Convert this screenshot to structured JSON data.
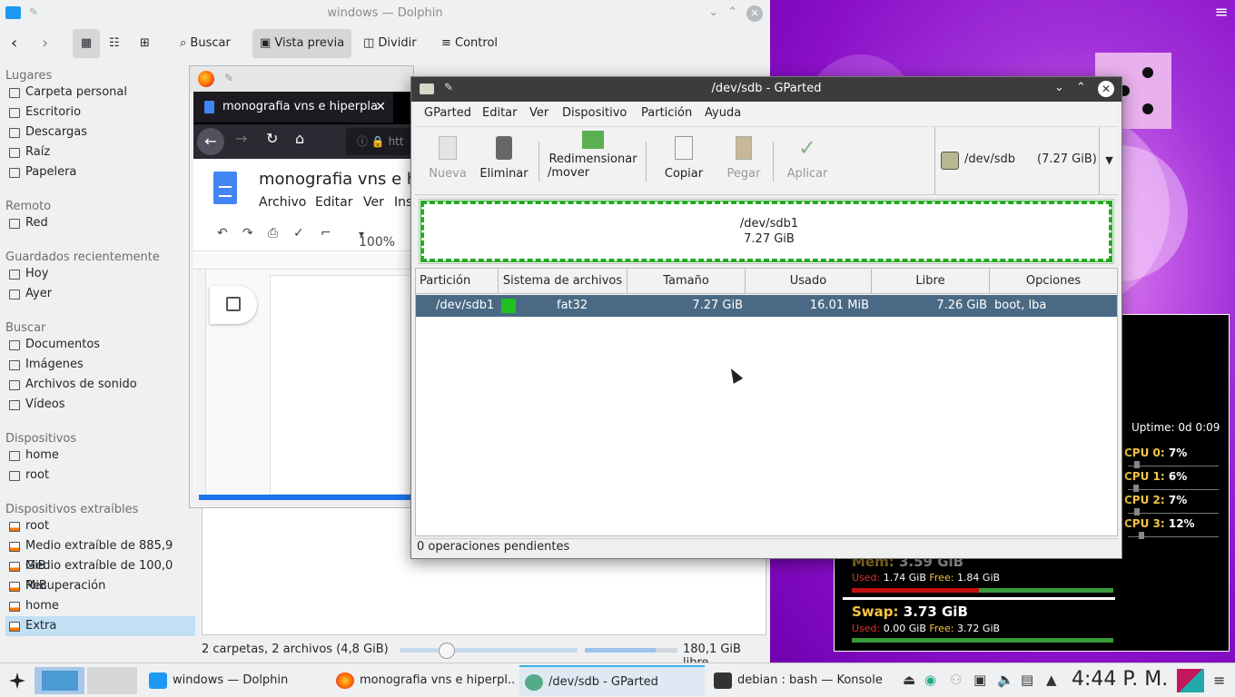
{
  "dolphin": {
    "title": "windows — Dolphin",
    "toolbar": {
      "search": "Buscar",
      "preview": "Vista previa",
      "split": "Dividir",
      "control": "Control"
    },
    "sections": [
      {
        "header": "Lugares",
        "items": [
          "Carpeta personal",
          "Escritorio",
          "Descargas",
          "Raíz",
          "Papelera"
        ]
      },
      {
        "header": "Remoto",
        "items": [
          "Red"
        ]
      },
      {
        "header": "Guardados recientemente",
        "items": [
          "Hoy",
          "Ayer"
        ]
      },
      {
        "header": "Buscar",
        "items": [
          "Documentos",
          "Imágenes",
          "Archivos de sonido",
          "Vídeos"
        ]
      },
      {
        "header": "Dispositivos",
        "items": [
          "home",
          "root"
        ]
      },
      {
        "header": "Dispositivos extraíbles",
        "items": [
          "root",
          "Medio extraíble de 885,9 GiB",
          "Medio extraíble de 100,0 MiB",
          "Recuperación",
          "home",
          "Extra"
        ]
      }
    ],
    "status": "2 carpetas, 2 archivos (4,8 GiB)",
    "free_space": "180,1 GiB libre"
  },
  "firefox": {
    "tab_title": "monografia vns e hiperpla",
    "url_fragment": "htt",
    "doc_title": "monografia vns e hip",
    "doc_menu": [
      "Archivo",
      "Editar",
      "Ver",
      "Ins"
    ],
    "zoom": "100%"
  },
  "gparted": {
    "title": "/dev/sdb - GParted",
    "menu": [
      "GParted",
      "Editar",
      "Ver",
      "Dispositivo",
      "Partición",
      "Ayuda"
    ],
    "tools": {
      "new": "Nueva",
      "delete": "Eliminar",
      "resize_1": "Redimensionar",
      "resize_2": "/mover",
      "copy": "Copiar",
      "paste": "Pegar",
      "apply": "Aplicar"
    },
    "device": {
      "name": "/dev/sdb",
      "size": "(7.27 GiB)"
    },
    "map": {
      "name": "/dev/sdb1",
      "size": "7.27 GiB"
    },
    "columns": [
      "Partición",
      "Sistema de archivos",
      "Tamaño",
      "Usado",
      "Libre",
      "Opciones"
    ],
    "row": {
      "partition": "/dev/sdb1",
      "fs": "fat32",
      "size": "7.27 GiB",
      "used": "16.01 MiB",
      "free": "7.26 GiB",
      "flags": "boot, lba"
    },
    "status": "0 operaciones pendientes",
    "colors": {
      "fat32": "#20c020",
      "selection": "#4a6984"
    }
  },
  "conky": {
    "uptime_label": "Uptime:",
    "uptime_value": "0d 0:09",
    "cpus": [
      {
        "label": "CPU 0:",
        "value": "7%",
        "level": 0.07
      },
      {
        "label": "CPU 1:",
        "value": "6%",
        "level": 0.06
      },
      {
        "label": "CPU 2:",
        "value": "7%",
        "level": 0.07
      },
      {
        "label": "CPU 3:",
        "value": "12%",
        "level": 0.12
      }
    ],
    "mem": {
      "label": "Mem:",
      "total": "3.59 GiB",
      "used_label": "Used:",
      "used": "1.74 GiB",
      "free_label": "Free:",
      "free": "1.84 GiB",
      "used_fraction": 0.485
    },
    "swap": {
      "label": "Swap:",
      "total": "3.73 GiB",
      "used_label": "Used:",
      "used": "0.00 GiB",
      "free_label": "Free:",
      "free": "3.72 GiB",
      "used_fraction": 0.0
    }
  },
  "taskbar": {
    "tasks": [
      "windows — Dolphin",
      "monografia vns e hiperpl...",
      "/dev/sdb - GParted",
      "debian : bash — Konsole"
    ],
    "clock": "4:44 P. M."
  }
}
